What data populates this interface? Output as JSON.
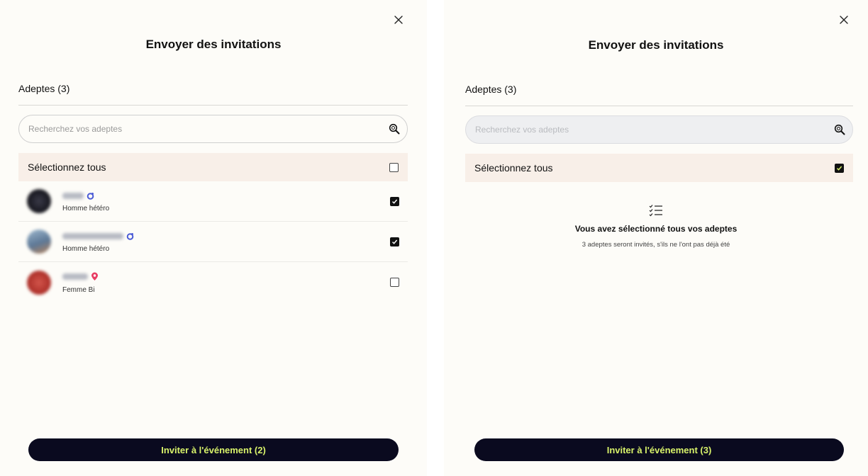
{
  "left": {
    "title": "Envoyer des invitations",
    "section_label": "Adeptes (3)",
    "search": {
      "placeholder": "Recherchez vos adeptes"
    },
    "select_all": {
      "label": "Sélectionnez tous",
      "checked": false
    },
    "members": [
      {
        "subtitle": "Homme hétéro",
        "badge": "ring-badge-icon",
        "checked": true,
        "avatar_color": "#1c1c26"
      },
      {
        "subtitle": "Homme hétéro",
        "badge": "ring-badge-icon",
        "checked": true,
        "avatar_color": "#6d8fb0"
      },
      {
        "subtitle": "Femme Bi",
        "badge": "location-pin-icon",
        "checked": false,
        "avatar_color": "#b7322b"
      }
    ],
    "invite_button": "Inviter à l'événement (2)"
  },
  "right": {
    "title": "Envoyer des invitations",
    "section_label": "Adeptes (3)",
    "search": {
      "placeholder": "Recherchez vos adeptes"
    },
    "select_all": {
      "label": "Sélectionnez tous",
      "checked": true
    },
    "empty_state": {
      "icon": "checklist-icon",
      "title": "Vous avez sélectionné tous vos adeptes",
      "subtitle": "3 adeptes seront invités, s'ils ne l'ont pas déjà été"
    },
    "invite_button": "Inviter à l'événement (3)"
  },
  "colors": {
    "panel_bg": "#fdfcf8",
    "select_all_bg": "#f8efe8",
    "button_bg": "#0a0a1f",
    "button_text": "#d8f26a",
    "ring_badge": "#4b5bd6",
    "pin_badge": "#e83d63"
  }
}
